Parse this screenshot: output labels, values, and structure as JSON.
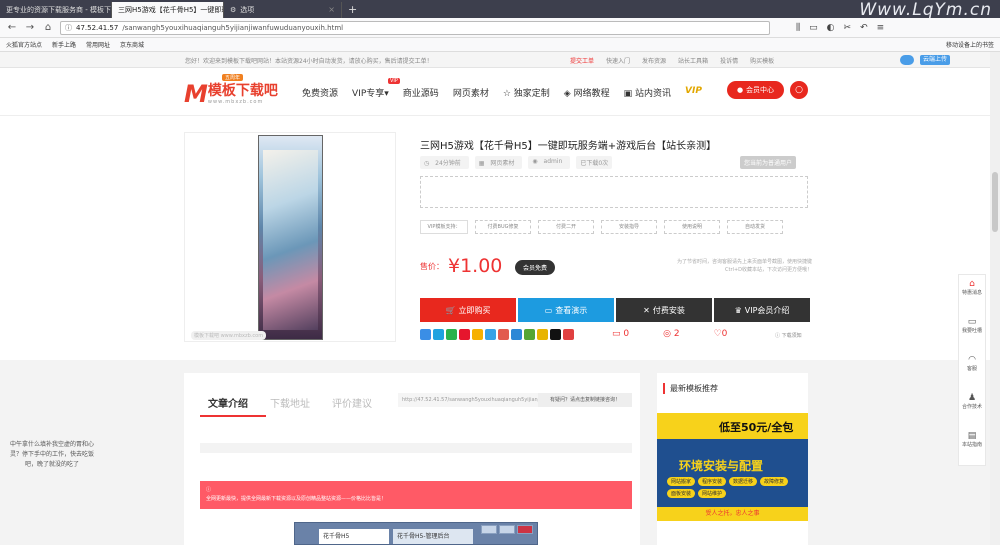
{
  "browser": {
    "tabs": [
      {
        "label": "更专业的资源下载服务商 - 模板下载吧"
      },
      {
        "label": "三网H5游戏【花千骨H5】一键即玩..."
      },
      {
        "label": "选项"
      }
    ],
    "watermark": "Www.LqYm.cn",
    "url_host": "47.52.41.57",
    "url_path": "/sanwangh5youxihuaqianguh5yijianjiwanfuwuduanyouxih.html",
    "bookmarks": [
      "火狐官方站点",
      "新手上路",
      "常用网址",
      "京东商城"
    ],
    "bookmarks_right": "移动设备上的书签"
  },
  "topstrip": {
    "notice": "您好！欢迎来到模板下载吧网站！本站资源24小时自动发货，请放心购买，售后请提交工单！",
    "links": [
      "提交工单",
      "快速入门",
      "发布资源",
      "站长工具箱",
      "投诉情",
      "购买模板"
    ],
    "cloud_btn": "云端上传"
  },
  "header": {
    "logo_name": "模板下载吧",
    "logo_sub": "www.mbxzb.com",
    "logo_badge": "五周年",
    "menu": [
      "免费资源",
      "VIP专享",
      "商业源码",
      "网页素材",
      "独家定制",
      "网络教程",
      "站内资讯"
    ],
    "vip_badge": "VIP",
    "vip_mark": "VIP",
    "member_btn": "会员中心"
  },
  "product": {
    "title": "三网H5游戏【花千骨H5】一键即玩服务端+游戏后台【站长亲测】",
    "meta": [
      "24分钟前",
      "网页素材",
      "admin",
      "已下载0次"
    ],
    "level": "您当前为普通用户",
    "image_caption": "模板下载吧 www.mbxzb.com",
    "services": [
      "VIP模板支持：",
      "付费BUG修复",
      "付费二开",
      "安装指导",
      "使用说明",
      "自动发货"
    ],
    "price_label": "售价：",
    "price": "¥1.00",
    "free_btn": "会员免费",
    "note": "为了节省时间，咨询客服请先上来页面单号截图，使用快捷键Ctrl+D收藏本站，下次访问更方便哦！",
    "actions": [
      "立即购买",
      "查看演示",
      "付费安装",
      "VIP会员介绍"
    ],
    "comments": "0",
    "views": "2",
    "likes": "0",
    "report": "下载须知"
  },
  "content": {
    "tabs": [
      "文章介绍",
      "下载地址",
      "评价建议"
    ],
    "url": "http://47.52.41.57/sanwangh5youxihuaqianguh5yijianjiwanfu",
    "ask": "有疑问？请点击复制链接咨询！",
    "red_notice": "全网更新最快，提供全网最新下载资源以及原创精品整站资源——价格比比皆是！"
  },
  "sidebar": {
    "title": "最新模板推荐",
    "ad_title": "低至50元/全包",
    "ad_main": "环境安装与配置",
    "ad_pills": [
      "网站搬家",
      "程序安装",
      "数据迁移",
      "故障修复",
      "面板安装",
      "网站维护"
    ],
    "ad_foot": "受人之托，忠人之事"
  },
  "right_bar": [
    "特惠消息",
    "我要吐槽",
    "客服",
    "合作技术",
    "本站指南"
  ],
  "left_text": "中午拿什么填补我空虚的胃和心灵？停下手中的工作，快去吃饭吧，晚了就没的吃了",
  "taskbar": {
    "win1": "花千骨H5",
    "win2": "花千骨H5-管理后台"
  },
  "colors": {
    "brand": "#e8281e",
    "blue": "#1d9be0",
    "dark": "#333333"
  }
}
